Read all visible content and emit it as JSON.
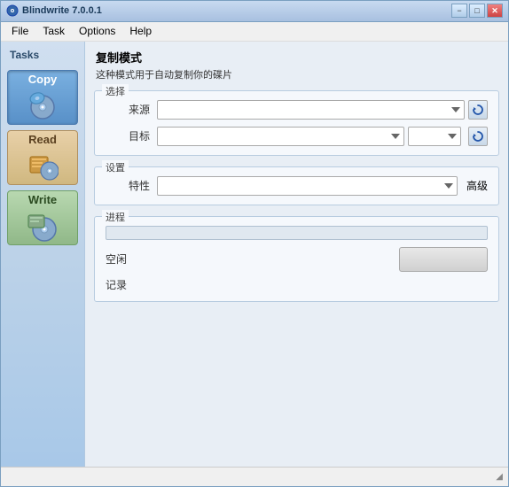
{
  "titlebar": {
    "title": "Blindwrite 7.0.0.1",
    "minimize_label": "−",
    "maximize_label": "□",
    "close_label": "✕"
  },
  "menubar": {
    "items": [
      {
        "label": "File"
      },
      {
        "label": "Task"
      },
      {
        "label": "Options"
      },
      {
        "label": "Help"
      }
    ]
  },
  "page": {
    "title": "复制模式",
    "subtitle": "这种模式用于自动复制你的碟片"
  },
  "sidebar": {
    "tasks_label": "Tasks",
    "buttons": [
      {
        "label": "Copy",
        "state": "active"
      },
      {
        "label": "Read",
        "state": "inactive"
      },
      {
        "label": "Write",
        "state": "inactive2"
      }
    ]
  },
  "select_section": {
    "label": "选择",
    "source_label": "来源",
    "target_label": "目标",
    "source_placeholder": "",
    "target_placeholder": "",
    "target_small_placeholder": ""
  },
  "settings_section": {
    "label": "设置",
    "property_label": "特性",
    "advanced_label": "高级",
    "property_placeholder": ""
  },
  "progress_section": {
    "label": "进程",
    "status_label": "空闲",
    "log_label": "记录",
    "start_button_label": "",
    "progress_pct": 0
  },
  "statusbar": {
    "text": "",
    "resize_icon": "◢"
  }
}
